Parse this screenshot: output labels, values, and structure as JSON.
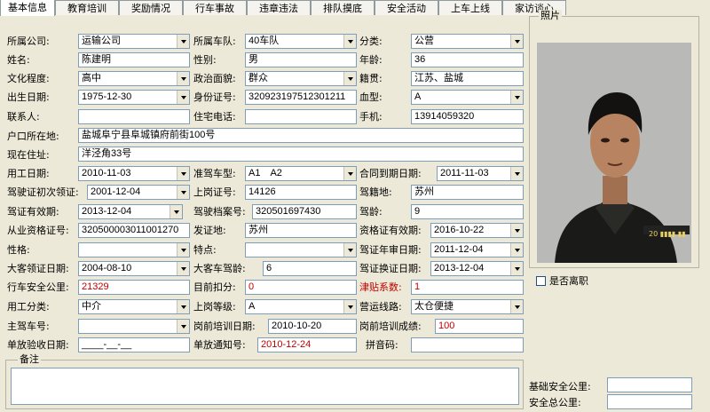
{
  "tabs": [
    "基本信息",
    "教育培训",
    "奖励情况",
    "行车事故",
    "违章违法",
    "排队摸底",
    "安全活动",
    "上车上线",
    "家访谈心"
  ],
  "fields": {
    "company_label": "所属公司:",
    "company": "运输公司",
    "team_label": "所属车队:",
    "team": "40车队",
    "category_label": "分类:",
    "category": "公营",
    "name_label": "姓名:",
    "name": "陈建明",
    "gender_label": "性别:",
    "gender": "男",
    "age_label": "年龄:",
    "age": "36",
    "edu_label": "文化程度:",
    "edu": "高中",
    "politics_label": "政治面貌:",
    "politics": "群众",
    "native_label": "籍贯:",
    "native": "江苏、盐城",
    "birth_label": "出生日期:",
    "birth": "1975-12-30",
    "idno_label": "身份证号:",
    "idno": "320923197512301211",
    "blood_label": "血型:",
    "blood": "A",
    "contact_label": "联系人:",
    "contact": "",
    "homephone_label": "住宅电话:",
    "homephone": "",
    "mobile_label": "手机:",
    "mobile": "13914059320",
    "hukou_label": "户口所在地:",
    "hukou": "盐城阜宁县阜城镇府前街100号",
    "address_label": "现在住址:",
    "address": "洋泾角33号",
    "hire_label": "用工日期:",
    "hire": "2010-11-03",
    "vehicle_label": "准驾车型:",
    "vehicle": "A1　A2",
    "contract_label": "合同到期日期:",
    "contract": "2011-11-03",
    "firstlic_label": "驾驶证初次领证:",
    "firstlic": "2001-12-04",
    "postcert_label": "上岗证号:",
    "postcert": "14126",
    "drvloc_label": "驾籍地:",
    "drvloc": "苏州",
    "licvalid_label": "驾证有效期:",
    "licvalid": "2013-12-04",
    "archive_label": "驾驶档案号:",
    "archive": "320501697430",
    "drvage_label": "驾龄:",
    "drvage": "9",
    "qual_label": "从业资格证号:",
    "qual": "320500003011001270",
    "issue_label": "发证地:",
    "issue": "苏州",
    "qualvalid_label": "资格证有效期:",
    "qualvalid": "2016-10-22",
    "character_label": "性格:",
    "character": "",
    "feature_label": "特点:",
    "feature": "",
    "annual_label": "驾证年审日期:",
    "annual": "2011-12-04",
    "bus_label": "大客领证日期:",
    "bus": "2004-08-10",
    "busage_label": "大客车驾龄:",
    "busage": "6",
    "renew_label": "驾证换证日期:",
    "renew": "2013-12-04",
    "safekm_label": "行车安全公里:",
    "safekm": "21329",
    "deduct_label": "目前扣分:",
    "deduct": "0",
    "coef_label": "津贴系数:",
    "coef": "1",
    "emptype_label": "用工分类:",
    "emptype": "中介",
    "level_label": "上岗等级:",
    "level": "A",
    "route_label": "营运线路:",
    "route": "太仓便捷",
    "mainveh_label": "主驾车号:",
    "mainveh": "",
    "train_label": "岗前培训日期:",
    "train": "2010-10-20",
    "trainscore_label": "岗前培训成绩:",
    "trainscore": "100",
    "accept_label": "单放验收日期:",
    "accept": "____-__-__",
    "notice_label": "单放通知号:",
    "notice": "2010-12-24",
    "pinyin_label": "拼音码:",
    "pinyin": ""
  },
  "photo_label": "照片",
  "photo_stamp": "20 ▮▮▮▮ ▮▮",
  "resign_label": "是否离职",
  "remark_label": "备注",
  "base_km_label": "基础安全公里:",
  "total_km_label": "安全总公里:"
}
